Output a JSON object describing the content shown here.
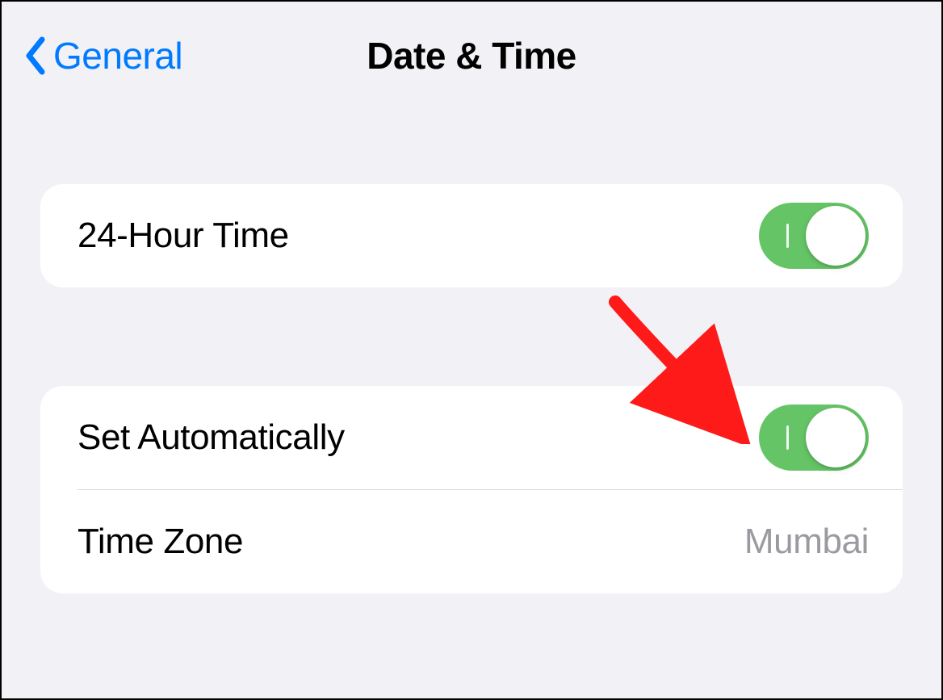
{
  "nav": {
    "back_label": "General",
    "title": "Date & Time"
  },
  "group1": {
    "rows": [
      {
        "label": "24-Hour Time",
        "toggle_on": true
      }
    ]
  },
  "group2": {
    "rows": [
      {
        "label": "Set Automatically",
        "toggle_on": true
      },
      {
        "label": "Time Zone",
        "value": "Mumbai"
      }
    ]
  },
  "colors": {
    "accent": "#007aff",
    "toggle_on": "#65c566",
    "background": "#f2f2f6",
    "secondary_text": "#9a9aa0"
  },
  "annotation": {
    "arrow_target": "set-automatically-toggle",
    "color": "#ff1a1a"
  }
}
